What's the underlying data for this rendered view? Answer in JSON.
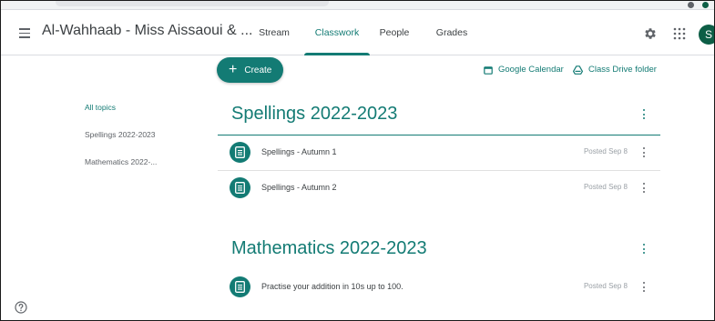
{
  "header": {
    "class_title": "Al-Wahhaab - Miss Aissaoui & ...",
    "tabs": [
      {
        "label": "Stream"
      },
      {
        "label": "Classwork"
      },
      {
        "label": "People"
      },
      {
        "label": "Grades"
      }
    ],
    "active_tab": "Classwork",
    "avatar_initial": "S"
  },
  "toolbar": {
    "create_label": "Create",
    "calendar_link": "Google Calendar",
    "drive_link": "Class Drive folder"
  },
  "sidebar": {
    "topics": [
      {
        "label": "All topics"
      },
      {
        "label": "Spellings 2022-2023"
      },
      {
        "label": "Mathematics 2022-..."
      }
    ]
  },
  "topics": [
    {
      "title": "Spellings 2022-2023",
      "items": [
        {
          "title": "Spellings - Autumn 1",
          "posted": "Posted Sep 8"
        },
        {
          "title": "Spellings - Autumn 2",
          "posted": "Posted Sep 8"
        }
      ]
    },
    {
      "title": "Mathematics 2022-2023",
      "items": [
        {
          "title": "Practise your addition in 10s up to 100.",
          "posted": "Posted Sep 8"
        }
      ]
    }
  ],
  "colors": {
    "accent": "#137b74",
    "avatar": "#0d5e46"
  },
  "icons": {
    "menu": "hamburger-menu-icon",
    "settings": "gear-icon",
    "apps": "apps-grid-icon",
    "calendar": "calendar-icon",
    "drive": "drive-icon",
    "assignment": "assignment-icon",
    "more": "more-vert-icon",
    "help": "help-icon"
  }
}
